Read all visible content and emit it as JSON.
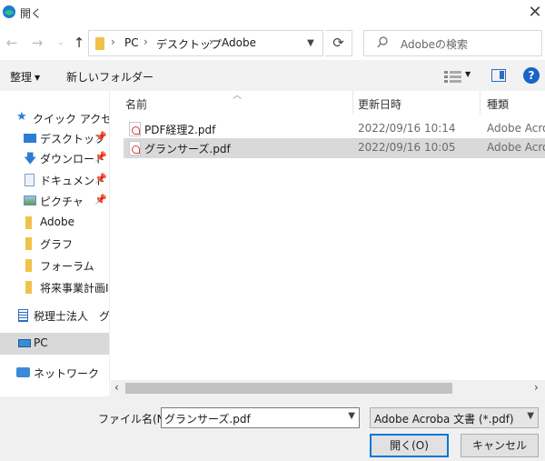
{
  "window": {
    "title": "開く"
  },
  "address": {
    "crumbs": [
      "PC",
      "デスクトップ",
      "Adobe"
    ]
  },
  "search": {
    "placeholder": "Adobeの検索"
  },
  "toolbar": {
    "organize": "整理",
    "new_folder": "新しいフォルダー"
  },
  "sidebar": {
    "items": [
      {
        "label": "クイック アクセス",
        "icon": "star-icon"
      },
      {
        "label": "デスクトップ",
        "icon": "desktop-icon"
      },
      {
        "label": "ダウンロード",
        "icon": "download-icon"
      },
      {
        "label": "ドキュメント",
        "icon": "document-icon"
      },
      {
        "label": "ピクチャ",
        "icon": "pictures-icon"
      },
      {
        "label": "Adobe",
        "icon": "folder-icon"
      },
      {
        "label": "グラフ",
        "icon": "folder-icon"
      },
      {
        "label": "フォーラム",
        "icon": "folder-icon"
      },
      {
        "label": "将来事業計画I",
        "icon": "folder-icon"
      },
      {
        "label": "税理士法人　グ",
        "icon": "building-icon"
      },
      {
        "label": "PC",
        "icon": "pc-icon"
      },
      {
        "label": "ネットワーク",
        "icon": "network-icon"
      }
    ]
  },
  "columns": {
    "name": "名前",
    "modified": "更新日時",
    "type": "種類"
  },
  "files": [
    {
      "name": "PDF経理2.pdf",
      "modified": "2022/09/16 10:14",
      "type": "Adobe Acrob"
    },
    {
      "name": "グランサーズ.pdf",
      "modified": "2022/09/16 10:05",
      "type": "Adobe Acrob"
    }
  ],
  "bottom": {
    "filename_label": "ファイル名(N):",
    "filename_value": "グランサーズ.pdf",
    "filetype": "Adobe Acroba 文書 (*.pdf)",
    "open_label": "開く(O)",
    "cancel_label": "キャンセル"
  },
  "colors": {
    "accent": "#0078d7",
    "selection": "#d9d9d9",
    "folder": "#f1c24a"
  }
}
